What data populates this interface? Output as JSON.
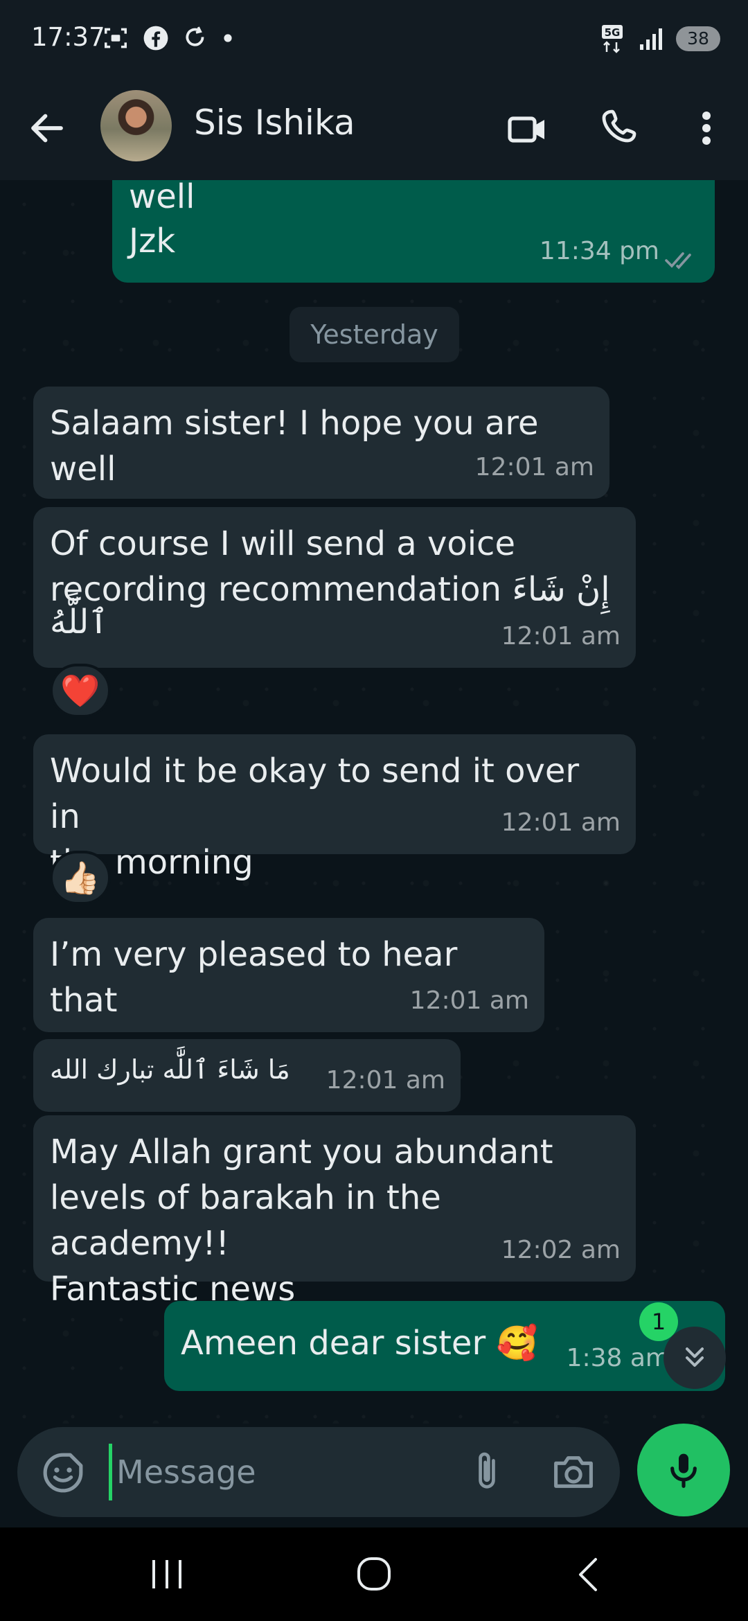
{
  "status_bar": {
    "time": "17:37",
    "network": "5G",
    "battery": "38"
  },
  "header": {
    "contact_name": "Sis Ishika"
  },
  "messages": [
    {
      "direction": "out",
      "text_line1": "well",
      "text_line2": "Jzk",
      "time": "11:34 pm",
      "status": "read"
    },
    {
      "direction": "in",
      "text": "Salaam sister! I hope you are well",
      "time": "12:01 am"
    },
    {
      "direction": "in",
      "text_line1": "Of course I will send a voice",
      "text_line2": "recording recommendation إِنْ شَاءَ",
      "text_line3": "ٱللَّهُ",
      "time": "12:01 am",
      "reaction": "❤️"
    },
    {
      "direction": "in",
      "text_line1": "Would it be okay to send it over in",
      "text_line2": "the morning",
      "time": "12:01 am",
      "reaction": "👍🏻"
    },
    {
      "direction": "in",
      "text": "I’m very pleased to hear that",
      "time": "12:01 am"
    },
    {
      "direction": "in",
      "text": "مَا شَاءَ ٱللَّٰه تبارك الله",
      "time": "12:01 am"
    },
    {
      "direction": "in",
      "text_line1": "May Allah grant you abundant",
      "text_line2": "levels of barakah in the academy!!",
      "text_line3": "Fantastic news",
      "time": "12:02 am"
    },
    {
      "direction": "out",
      "text": "Ameen dear sister 🥰",
      "time": "1:38 am"
    }
  ],
  "date_divider": "Yesterday",
  "unread_count": "1",
  "composer": {
    "placeholder": "Message"
  },
  "icons": {
    "back": "arrow-left-icon",
    "video": "video-call-icon",
    "call": "phone-icon",
    "menu": "more-vertical-icon",
    "emoji": "emoji-icon",
    "attach": "paperclip-icon",
    "camera": "camera-icon",
    "mic": "mic-icon"
  },
  "colors": {
    "background": "#0b141a",
    "incoming_bubble": "#202c33",
    "outgoing_bubble": "#005c4b",
    "accent": "#25d366"
  }
}
